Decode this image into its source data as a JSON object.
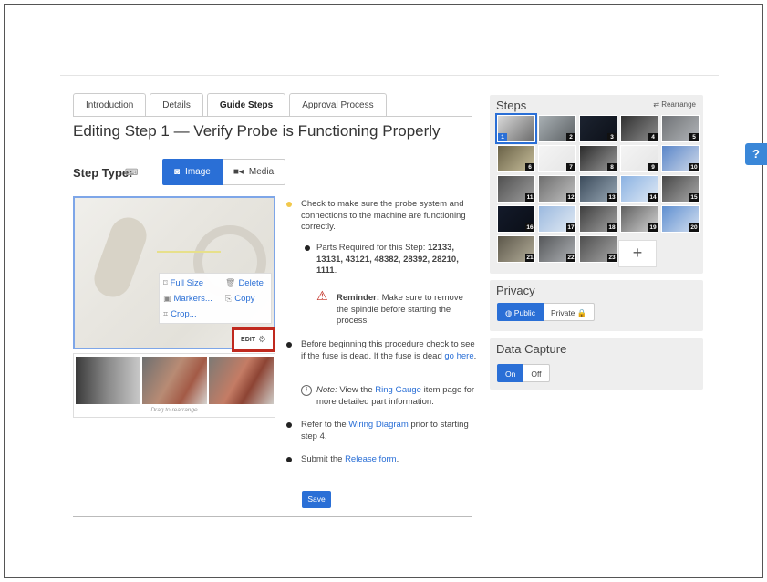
{
  "tabs": [
    {
      "label": "Introduction"
    },
    {
      "label": "Details"
    },
    {
      "label": "Guide Steps"
    },
    {
      "label": "Approval Process"
    }
  ],
  "page_title": "Editing Step 1 — Verify Probe is Functioning Properly",
  "step_type": {
    "label": "Step Type:",
    "options": [
      "Image",
      "Media"
    ],
    "selected": "Image"
  },
  "image_menu": {
    "full_size": "Full Size",
    "delete": "Delete",
    "markers": "Markers...",
    "copy": "Copy",
    "crop": "Crop..."
  },
  "edit_label": "EDIT",
  "drag_hint": "Drag to rearrange",
  "content": {
    "b1": "Check to make sure the probe system and connections to the machine are functioning correctly.",
    "b2_prefix": "Parts Required for this Step: ",
    "b2_parts": "12133, 13131, 43121, 48382, 28392, 28210, 1111",
    "b2_suffix": ".",
    "reminder_label": "Reminder:",
    "reminder_text": " Make sure to remove the spindle before starting the process.",
    "b3": "Before beginning this procedure check to see if the fuse is dead. If the fuse is dead ",
    "b3_link": "go here",
    "b3_end": ".",
    "note_label": "Note:",
    "note_pre": " View the ",
    "note_link": "Ring Gauge",
    "note_post": " item page for more detailed part information.",
    "b4_pre": "Refer to the ",
    "b4_link": "Wiring Diagram",
    "b4_post": " prior to starting step 4.",
    "b5_pre": "Submit the ",
    "b5_link": "Release form",
    "b5_post": "."
  },
  "save_label": "Save",
  "steps_panel": {
    "title": "Steps",
    "rearrange": "Rearrange",
    "numbers": [
      "1",
      "2",
      "3",
      "4",
      "5",
      "6",
      "7",
      "8",
      "9",
      "10",
      "11",
      "12",
      "13",
      "14",
      "15",
      "16",
      "17",
      "18",
      "19",
      "20",
      "21",
      "22",
      "23"
    ],
    "add": "+"
  },
  "privacy": {
    "title": "Privacy",
    "public": "Public",
    "private": "Private"
  },
  "data_capture": {
    "title": "Data Capture",
    "on": "On",
    "off": "Off"
  },
  "help_label": "?",
  "colors": {
    "accent": "#2a6fd6",
    "bullet_yellow": "#f2c84b",
    "warning_red": "#c0291e"
  }
}
